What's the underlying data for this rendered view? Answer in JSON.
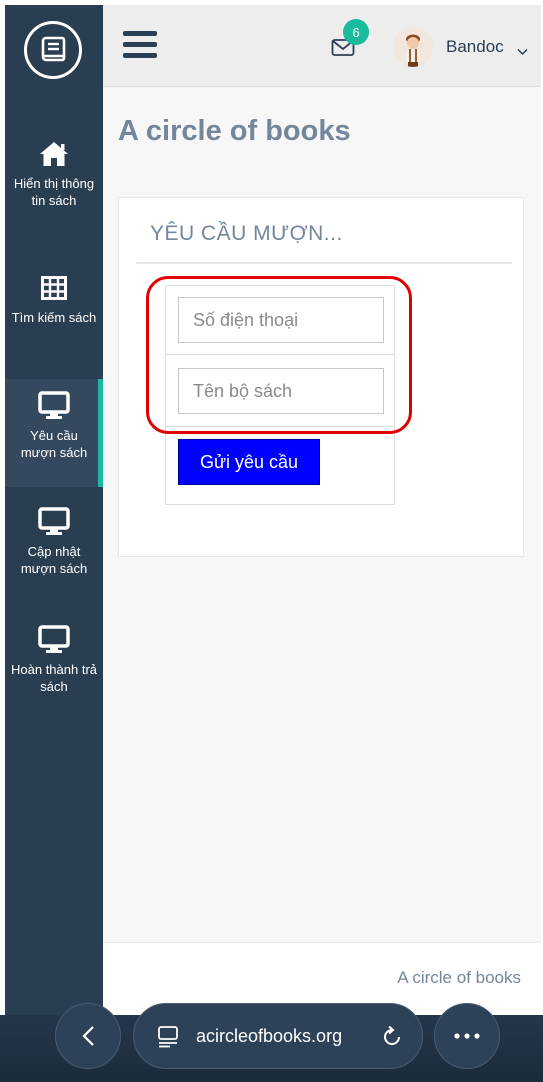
{
  "sidebar": {
    "items": [
      {
        "label": "Hiển thị thông tin sách",
        "icon": "home-icon",
        "active": false
      },
      {
        "label": "Tìm kiếm sách",
        "icon": "table-icon",
        "active": false
      },
      {
        "label": "Yêu cầu mượn sách",
        "icon": "desktop-icon",
        "active": true
      },
      {
        "label": "Cập nhật mượn sách",
        "icon": "desktop-icon",
        "active": false
      },
      {
        "label": "Hoàn thành trả sách",
        "icon": "desktop-icon",
        "active": false
      }
    ]
  },
  "header": {
    "notification_count": "6",
    "user_name": "Bandoc"
  },
  "page": {
    "title": "A circle of books"
  },
  "panel": {
    "title": "YÊU CẦU MƯỢN...",
    "phone_placeholder": "Số điện thoại",
    "book_placeholder": "Tên bộ sách",
    "submit_label": "Gửi yêu cầu"
  },
  "footer": {
    "text": "A circle of books"
  },
  "browser": {
    "url": "acircleofbooks.org"
  },
  "colors": {
    "sidebar_bg": "#2a3e52",
    "accent": "#1abb9c",
    "submit_button": "#0000ff",
    "highlight_ring": "#e00000",
    "muted_text": "#73879c"
  }
}
